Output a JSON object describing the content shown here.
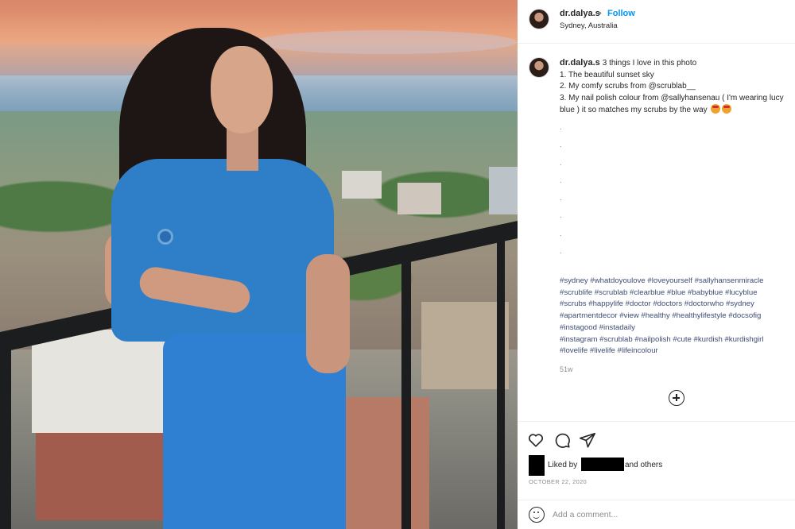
{
  "post": {
    "username": "dr.dalya.s",
    "separator": "•",
    "follow_label": "Follow",
    "location": "Sydney, Australia"
  },
  "caption": {
    "username": "dr.dalya.s",
    "line1": "3 things I love in this photo",
    "line2": "1. The beautiful sunset sky",
    "line3": "2. My comfy scrubs from @scrublab__",
    "line4": "3. My nail polish colour from @sallyhansenau ( I'm wearing lucy",
    "line5": "blue ) it so matches my scrubs by the way",
    "dots": ".\n.\n.\n.\n.\n.\n.\n.",
    "hashtags": [
      "#sydney #whatdoyoulove #loveyourself #sallyhansenmiracle",
      "#scrublife #scrublab #clearblue #blue #babyblue #lucyblue",
      "#scrubs #happylife #doctor #doctors #doctorwho #sydney",
      "#apartmentdecor #view #healthy #healthylifestyle #docsofig",
      "#instagood #instadaily",
      "#instagram #scrublab #nailpolish #cute #kurdish #kurdishgirl",
      "#lovelife #livelife #lifeincolour"
    ],
    "time_ago": "51w"
  },
  "actions": {
    "like_icon": "heart-icon",
    "comment_icon": "comment-icon",
    "share_icon": "share-icon",
    "liked_by_label": "Liked by",
    "and_others": "and others",
    "date": "OCTOBER 22, 2020"
  },
  "comment": {
    "placeholder": "Add a comment..."
  },
  "colors": {
    "follow": "#0095f6",
    "hashtag": "#3d4d74",
    "scrubs": "#2f7fc8"
  }
}
